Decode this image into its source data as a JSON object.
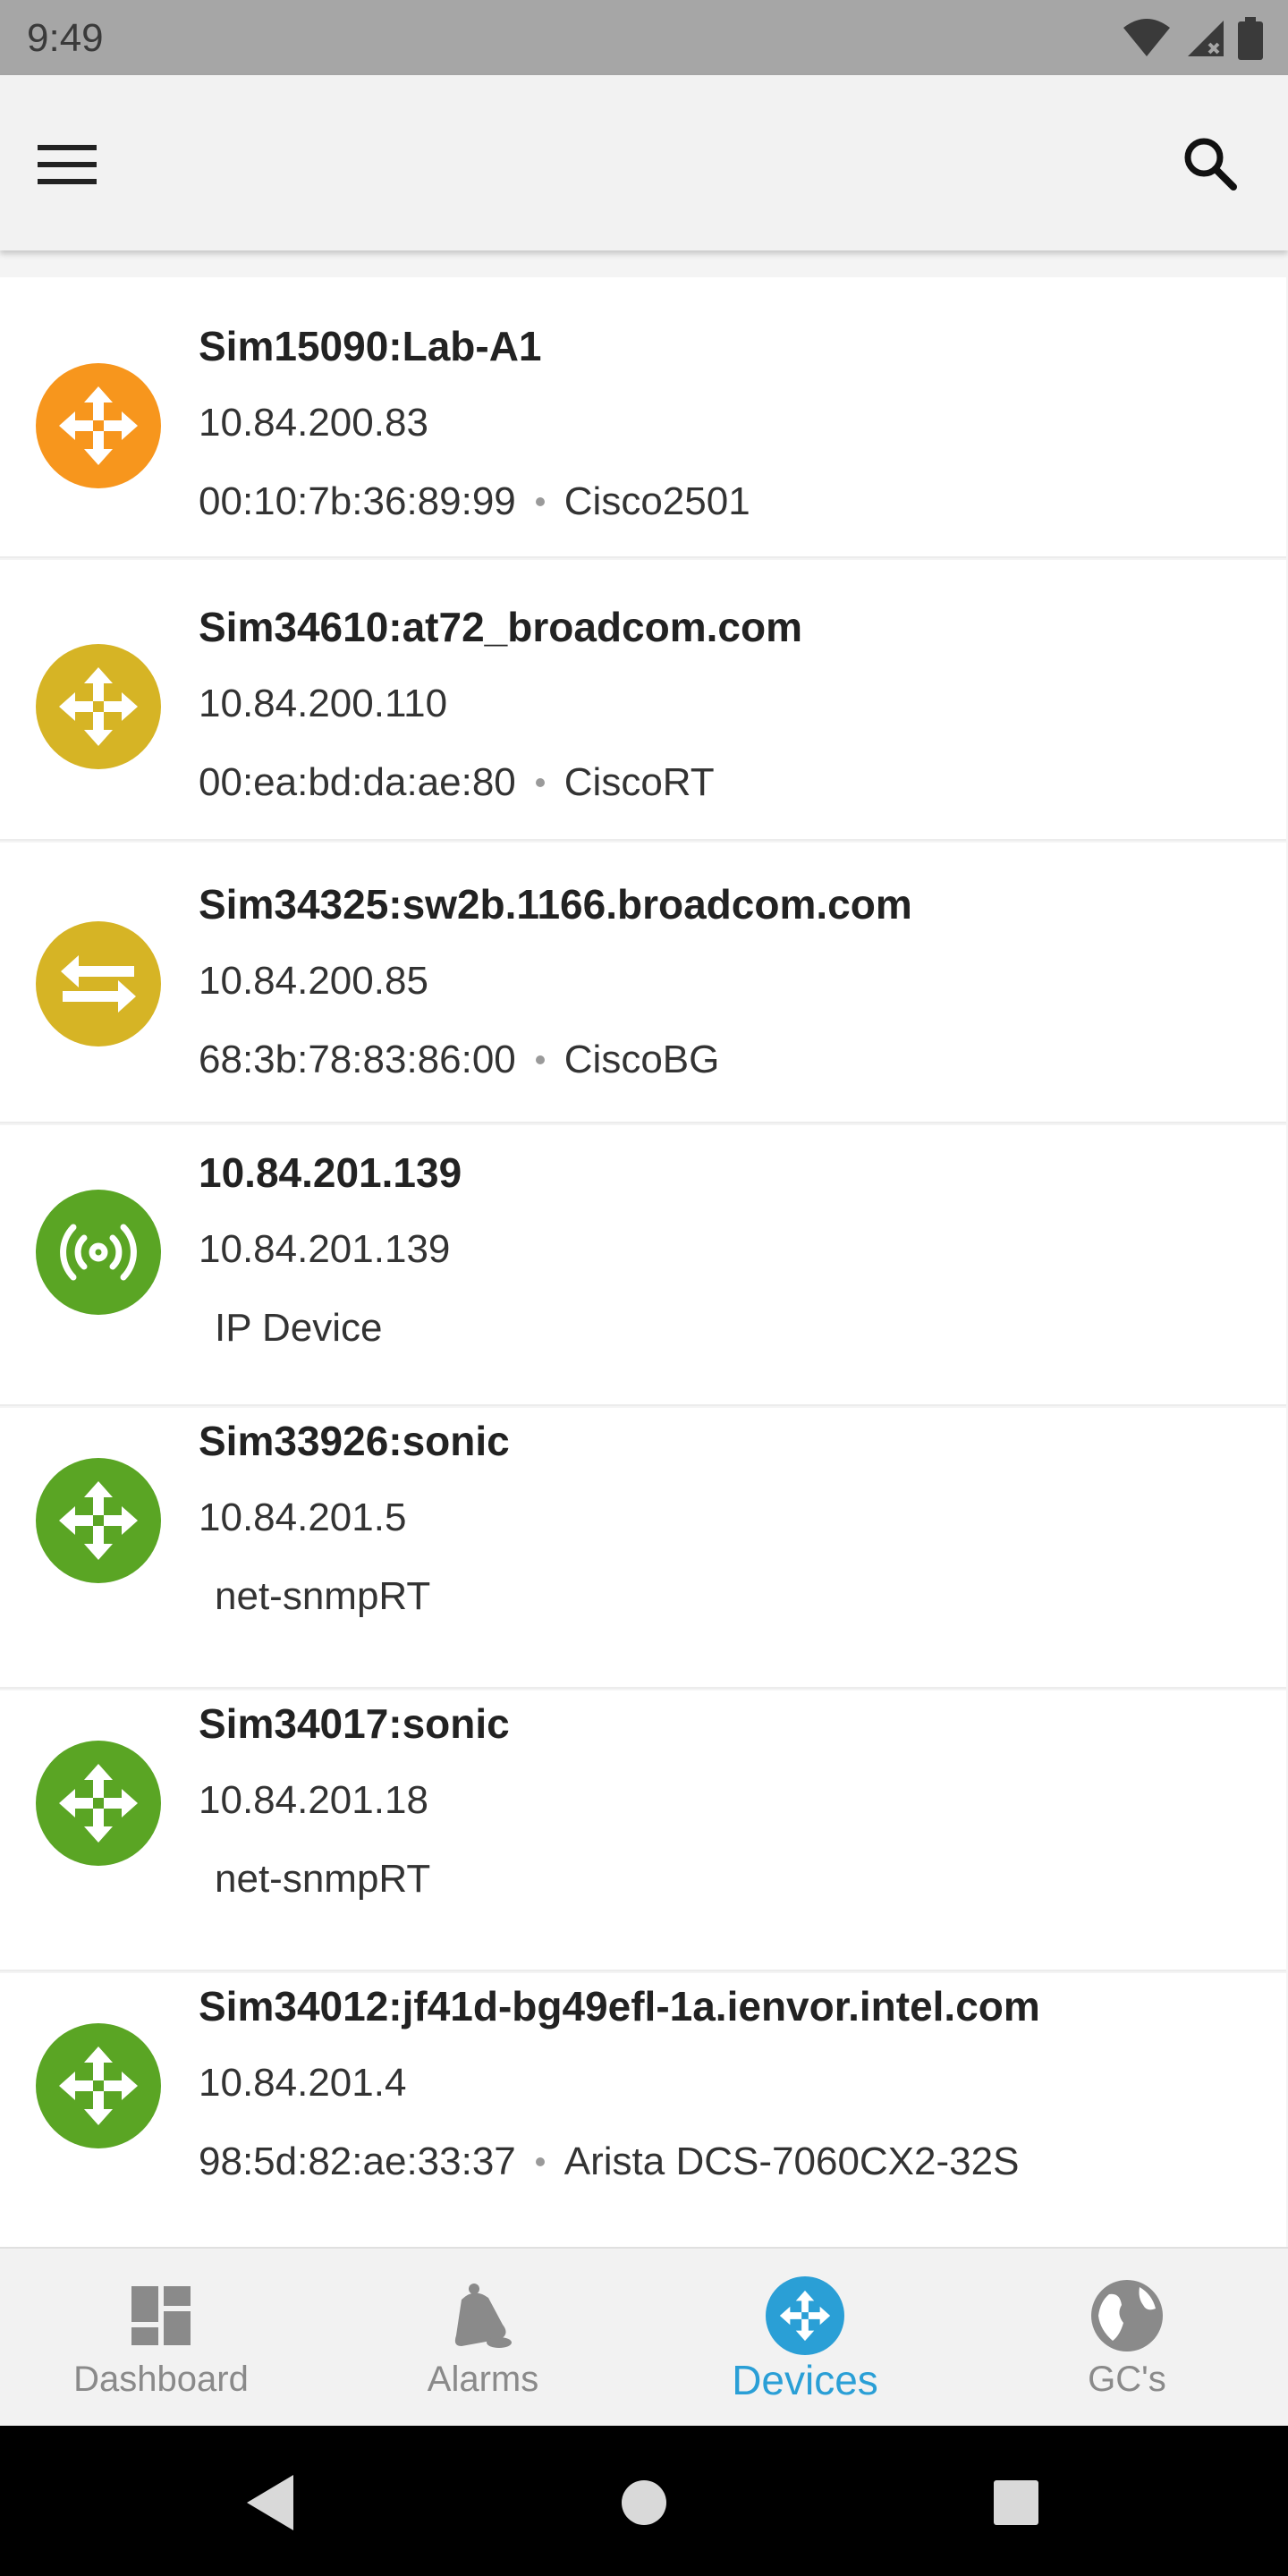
{
  "status_bar": {
    "time": "9:49",
    "icons": [
      "wifi-icon",
      "cell-signal-icon",
      "battery-icon"
    ]
  },
  "app_bar": {
    "menu_icon": "hamburger-menu-icon",
    "search_icon": "search-icon"
  },
  "colors": {
    "orange": "#f7961d",
    "mustard": "#d6b425",
    "green": "#5aa524",
    "accent": "#2a9fd6"
  },
  "devices": [
    {
      "name": "Sim15090:Lab-A1",
      "ip": "10.84.200.83",
      "mac": "00:10:7b:36:89:99",
      "model": "Cisco2501",
      "icon": "router-icon",
      "color": "#f7961d"
    },
    {
      "name": "Sim34610:at72_broadcom.com",
      "ip": "10.84.200.110",
      "mac": "00:ea:bd:da:ae:80",
      "model": "CiscoRT",
      "icon": "router-icon",
      "color": "#d6b425"
    },
    {
      "name": "Sim34325:sw2b.1166.broadcom.com",
      "ip": "10.84.200.85",
      "mac": "68:3b:78:83:86:00",
      "model": "CiscoBG",
      "icon": "switch-icon",
      "color": "#d6b425"
    },
    {
      "name": "10.84.201.139",
      "ip": "10.84.201.139",
      "mac": "",
      "model": "IP Device",
      "icon": "wireless-icon",
      "color": "#5aa524"
    },
    {
      "name": "Sim33926:sonic",
      "ip": "10.84.201.5",
      "mac": "",
      "model": "net-snmpRT",
      "icon": "router-icon",
      "color": "#5aa524"
    },
    {
      "name": "Sim34017:sonic",
      "ip": "10.84.201.18",
      "mac": "",
      "model": "net-snmpRT",
      "icon": "router-icon",
      "color": "#5aa524"
    },
    {
      "name": "Sim34012:jf41d-bg49efl-1a.ienvor.intel.com",
      "ip": "10.84.201.4",
      "mac": "98:5d:82:ae:33:37",
      "model": "Arista DCS-7060CX2-32S",
      "icon": "router-icon",
      "color": "#5aa524"
    }
  ],
  "bottom_nav": {
    "items": [
      {
        "label": "Dashboard",
        "icon": "dashboard-icon",
        "active": false
      },
      {
        "label": "Alarms",
        "icon": "bell-icon",
        "active": false
      },
      {
        "label": "Devices",
        "icon": "devices-icon",
        "active": true
      },
      {
        "label": "GC's",
        "icon": "globe-icon",
        "active": false
      }
    ]
  },
  "system_nav": [
    "back-icon",
    "home-icon",
    "recents-icon"
  ]
}
